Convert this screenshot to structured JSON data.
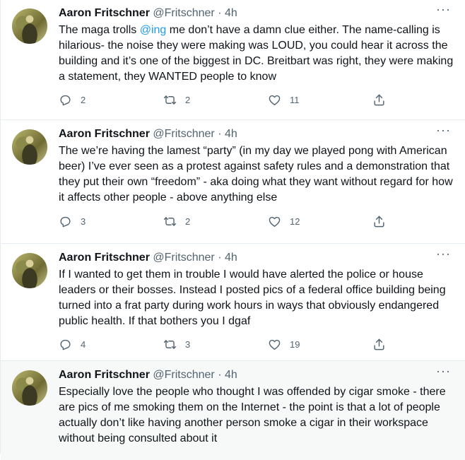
{
  "tweets": [
    {
      "name": "Aaron Fritschner",
      "handle": "@Fritschner",
      "sep": "·",
      "time": "4h",
      "more": "···",
      "text_before": "The maga trolls ",
      "mention": "@ing",
      "text_after": " me don’t have a damn clue either. The name-calling is hilarious- the noise they were making was LOUD, you could hear it across the building and it’s one of the biggest in DC. Breitbart was right, they were making a statement, they WANTED people to know",
      "replies": "2",
      "retweets": "2",
      "likes": "11"
    },
    {
      "name": "Aaron Fritschner",
      "handle": "@Fritschner",
      "sep": "·",
      "time": "4h",
      "more": "···",
      "text": "The we’re having the lamest “party” (in my day we played pong with American beer) I’ve ever seen as a protest against safety rules and a demonstration that they put their own “freedom” - aka doing what they want without regard for how it affects other people - above anything else",
      "replies": "3",
      "retweets": "2",
      "likes": "12"
    },
    {
      "name": "Aaron Fritschner",
      "handle": "@Fritschner",
      "sep": "·",
      "time": "4h",
      "more": "···",
      "text": "If I wanted to get them in trouble I would have alerted the police or house leaders or their bosses. Instead I posted pics of a federal office building being turned into a frat party during work hours in ways that obviously endangered public health. If that bothers you I dgaf",
      "replies": "4",
      "retweets": "3",
      "likes": "19"
    },
    {
      "name": "Aaron Fritschner",
      "handle": "@Fritschner",
      "sep": "·",
      "time": "4h",
      "more": "···",
      "text": "Especially love the people who thought I was offended by cigar smoke - there are pics of me smoking them on the Internet - the point is that a lot of people actually don’t like having another person smoke a cigar in their workspace without being consulted about it"
    }
  ]
}
